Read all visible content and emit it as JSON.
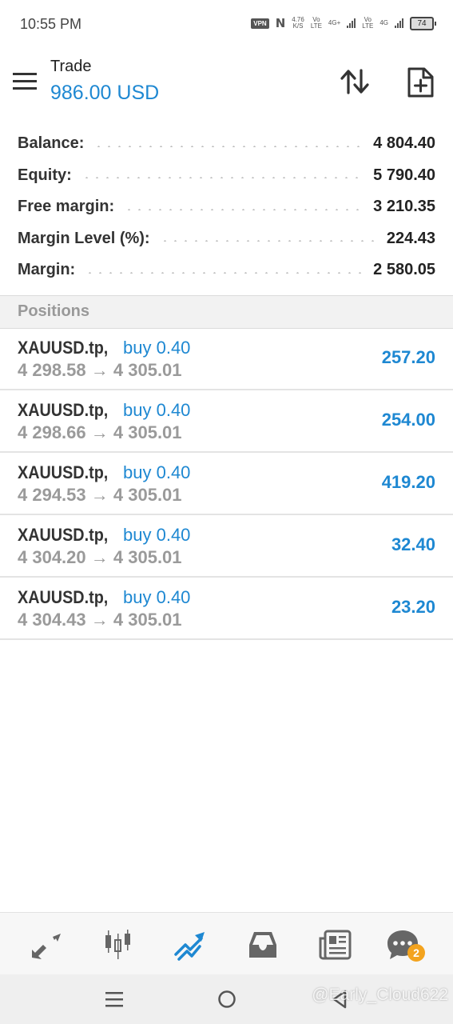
{
  "status_bar": {
    "time": "10:55 PM",
    "vpn": "VPN",
    "nfc": "N",
    "speed_value": "4.76",
    "speed_unit": "K/S",
    "sim1_top": "Vo",
    "sim1_bottom": "LTE",
    "sim1_network": "4G+",
    "sim2_top": "Vo",
    "sim2_bottom": "LTE",
    "sim2_network": "4G",
    "battery": "74"
  },
  "header": {
    "title": "Trade",
    "balance": "986.00 USD"
  },
  "summary": [
    {
      "label": "Balance:",
      "value": "4 804.40"
    },
    {
      "label": "Equity:",
      "value": "5 790.40"
    },
    {
      "label": "Free margin:",
      "value": "3 210.35"
    },
    {
      "label": "Margin Level (%):",
      "value": "224.43"
    },
    {
      "label": "Margin:",
      "value": "2 580.05"
    }
  ],
  "positions": {
    "header": "Positions",
    "items": [
      {
        "symbol": "XAUUSD.tp,",
        "side": "buy 0.40",
        "open": "4 298.58",
        "arrow": "→",
        "current": "4 305.01",
        "profit": "257.20"
      },
      {
        "symbol": "XAUUSD.tp,",
        "side": "buy 0.40",
        "open": "4 298.66",
        "arrow": "→",
        "current": "4 305.01",
        "profit": "254.00"
      },
      {
        "symbol": "XAUUSD.tp,",
        "side": "buy 0.40",
        "open": "4 294.53",
        "arrow": "→",
        "current": "4 305.01",
        "profit": "419.20"
      },
      {
        "symbol": "XAUUSD.tp,",
        "side": "buy 0.40",
        "open": "4 304.20",
        "arrow": "→",
        "current": "4 305.01",
        "profit": "32.40"
      },
      {
        "symbol": "XAUUSD.tp,",
        "side": "buy 0.40",
        "open": "4 304.43",
        "arrow": "→",
        "current": "4 305.01",
        "profit": "23.20"
      }
    ]
  },
  "bottom_nav": {
    "items": [
      {
        "icon": "quotes-arrows-icon",
        "active": false
      },
      {
        "icon": "candlestick-chart-icon",
        "active": false
      },
      {
        "icon": "trade-icon",
        "active": true
      },
      {
        "icon": "history-inbox-icon",
        "active": false
      },
      {
        "icon": "news-icon",
        "active": false
      },
      {
        "icon": "chat-icon",
        "active": false
      }
    ],
    "chat_badge": "2"
  },
  "system_nav": {
    "watermark": "@Early_Cloud622"
  },
  "colors": {
    "accent": "#1e88d2",
    "text": "#333333",
    "muted": "#9a9a9a",
    "badge": "#f3a31e"
  }
}
